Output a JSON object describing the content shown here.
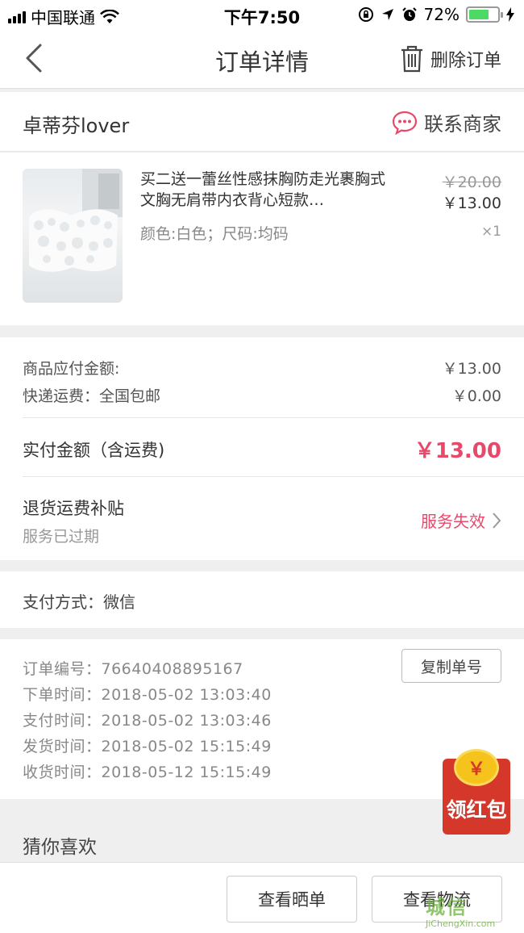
{
  "status_bar": {
    "carrier": "中国联通",
    "time": "下午7:50",
    "battery": "72%"
  },
  "nav": {
    "title": "订单详情",
    "delete_label": "删除订单"
  },
  "shop": {
    "name": "卓蒂芬lover",
    "contact_label": "联系商家"
  },
  "product": {
    "title": "买二送一蕾丝性感抹胸防走光裹胸式文胸无肩带内衣背心短款…",
    "spec": "颜色:白色；尺码:均码",
    "original_price": "￥20.00",
    "price": "￥13.00",
    "quantity": "×1"
  },
  "amounts": {
    "goods_label": "商品应付金额:",
    "goods_value": "￥13.00",
    "shipping_label": "快递运费：全国包邮",
    "shipping_value": "￥0.00",
    "paid_label": "实付金额（含运费)",
    "paid_value": "￥13.00"
  },
  "refund_subsidy": {
    "title": "退货运费补贴",
    "subtitle": "服务已过期",
    "status": "服务失效"
  },
  "payment": {
    "text": "支付方式：微信"
  },
  "order_info": {
    "lines": [
      "订单编号：76640408895167",
      "下单时间：2018-05-02  13:03:40",
      "支付时间：2018-05-02  13:03:46",
      "发货时间：2018-05-02  15:15:49",
      "收货时间：2018-05-12  15:15:49"
    ],
    "copy_label": "复制单号"
  },
  "recommend": {
    "title": "猜你喜欢"
  },
  "red_packet": {
    "coin": "￥",
    "label": "领红包"
  },
  "bottom_bar": {
    "review_label": "查看晒单",
    "logistics_label": "查看物流"
  },
  "watermark": {
    "main": "城信",
    "sub": "JiChengXin.com"
  },
  "colors": {
    "accent": "#e8496a",
    "red_packet": "#d6372b",
    "coin": "#f6c21c",
    "battery": "#4cd964"
  },
  "icons": [
    "signal-icon",
    "wifi-icon",
    "lock-rotation-icon",
    "location-icon",
    "alarm-icon",
    "battery-icon",
    "back-chevron-icon",
    "trash-icon",
    "chat-icon",
    "chevron-right-icon"
  ]
}
